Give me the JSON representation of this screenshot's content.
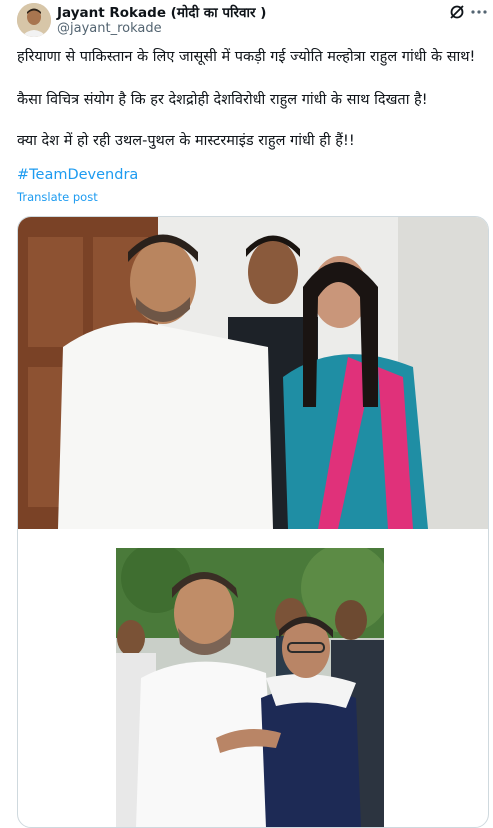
{
  "author": {
    "name": "Jayant Rokade (मोदी का परिवार )",
    "handle": "@jayant_rokade"
  },
  "icons": {
    "grok": "grok-icon",
    "more": "more-icon"
  },
  "tweet": {
    "line1": "हरियाणा से पाकिस्तान के लिए जासूसी में पकड़ी गई ज्योति मल्होत्रा राहुल गांधी के साथ!",
    "line2": "कैसा विचित्र संयोग है कि हर देशद्रोही देशविरोधी राहुल गांधी के साथ दिखता है!",
    "line3": "क्या देश में हो रही उथल-पुथल के मास्टरमाइंड राहुल गांधी ही हैं!!",
    "hashtag": "#TeamDevendra",
    "translate": "Translate post"
  }
}
